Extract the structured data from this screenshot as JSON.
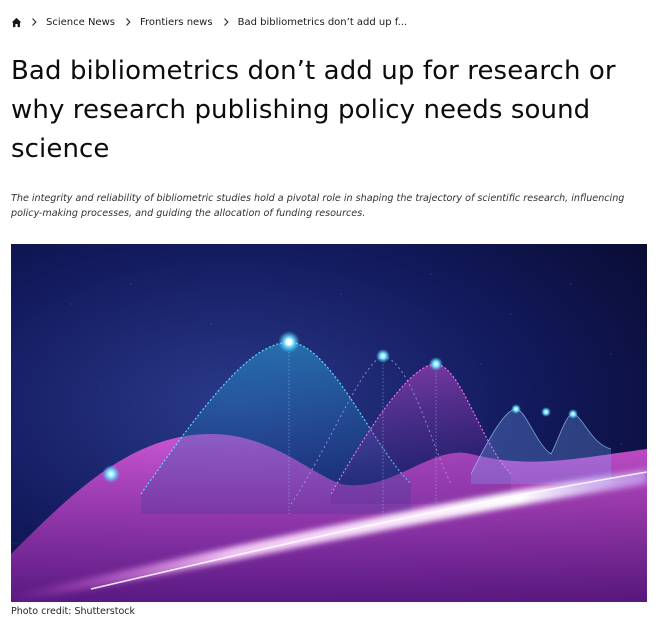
{
  "breadcrumb": {
    "home_icon": "home-icon",
    "separator_icon": "chevron-right-icon",
    "items": [
      {
        "label": "Science News"
      },
      {
        "label": "Frontiers news"
      },
      {
        "label": "Bad bibliometrics don’t add up f..."
      }
    ]
  },
  "article": {
    "title": "Bad bibliometrics don’t add up for research or why research publishing policy needs sound science",
    "lead": "The integrity and reliability of bibliometric studies hold a pivotal role in shaping the trajectory of scientific research, influencing policy-making processes, and guiding the allocation of funding resources.",
    "image_caption": "Photo credit: Shutterstock"
  },
  "colors": {
    "text": "#0c0c0d",
    "hero_background": "#0a0a3a",
    "accent_magenta": "#d04bd6",
    "accent_cyan": "#36c6ff"
  }
}
